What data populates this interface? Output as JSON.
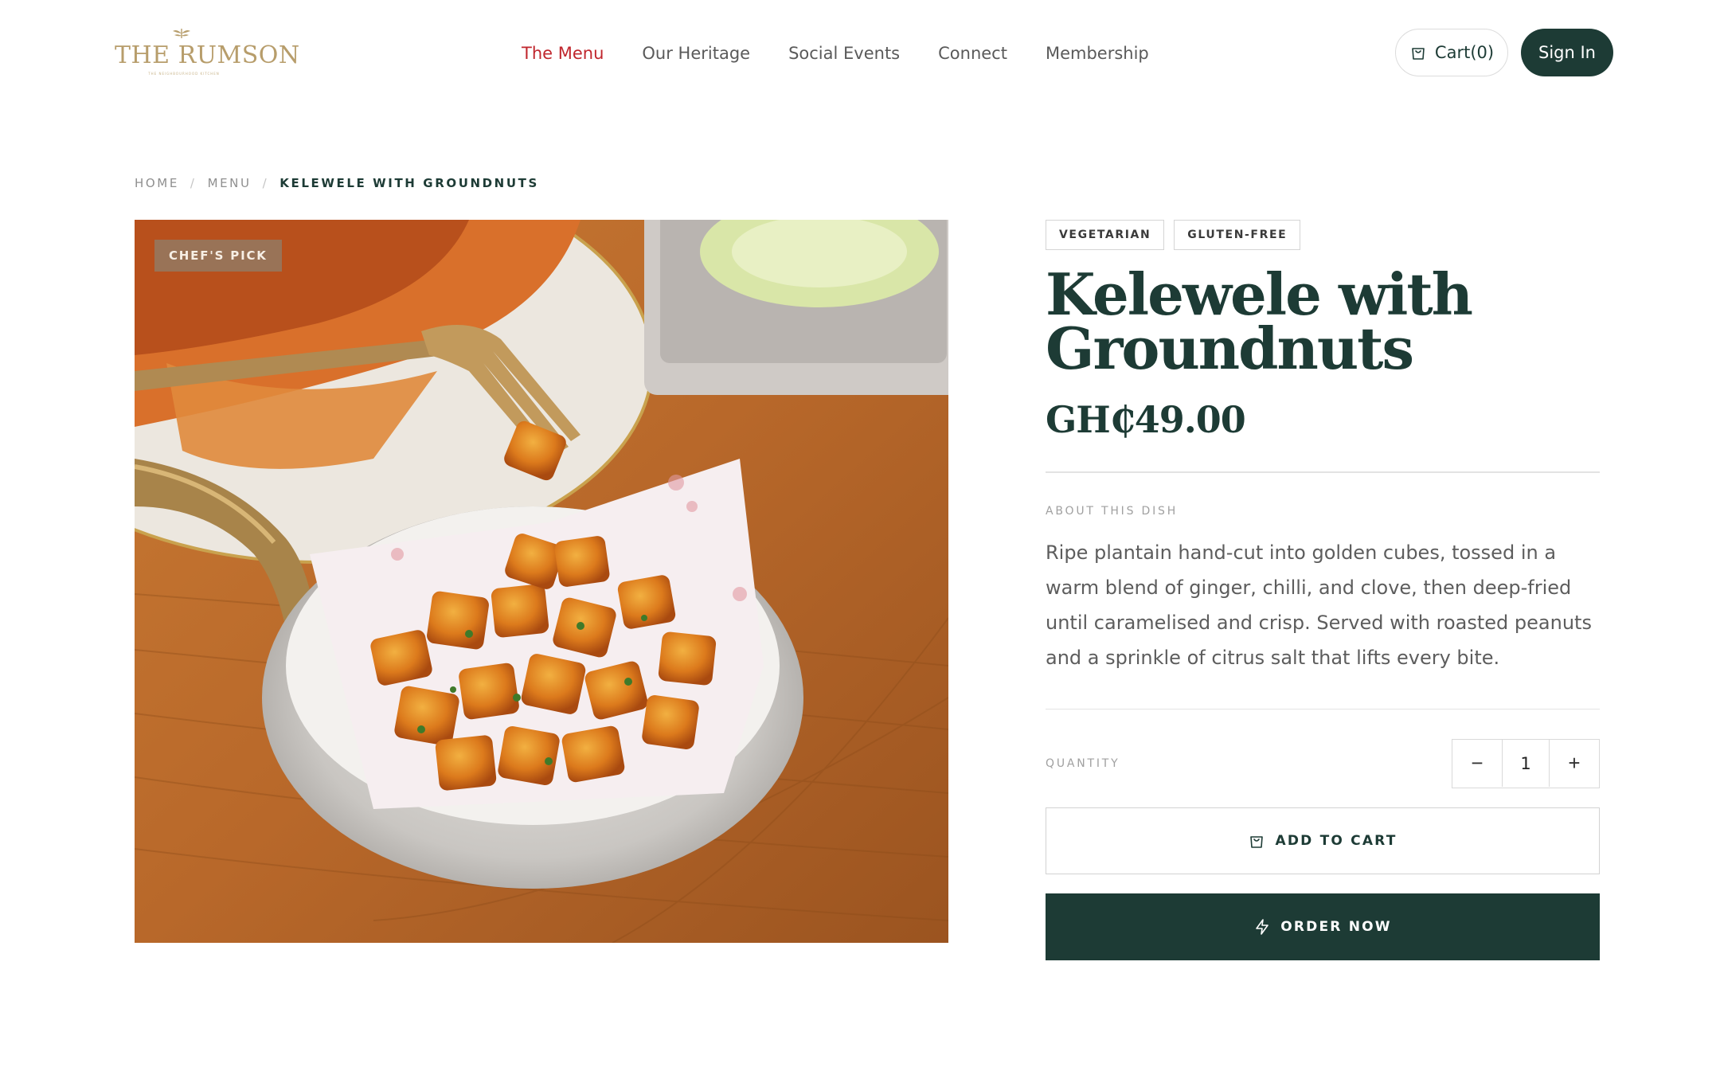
{
  "brand": {
    "name": "THE RUMSON",
    "tagline": "THE NEIGHBOURHOOD KITCHEN",
    "logo_icon": "leaf-crest-icon",
    "color": "#b79d6b"
  },
  "nav": {
    "items": [
      {
        "label": "The Menu",
        "active": true
      },
      {
        "label": "Our Heritage",
        "active": false
      },
      {
        "label": "Social Events",
        "active": false
      },
      {
        "label": "Connect",
        "active": false
      },
      {
        "label": "Membership",
        "active": false
      }
    ],
    "active_color": "#c0262d"
  },
  "header": {
    "cart_label": "Cart(0)",
    "cart_icon": "shopping-bag-icon",
    "signin_label": "Sign In"
  },
  "breadcrumb": {
    "items": [
      "HOME",
      "MENU"
    ],
    "separator": "/",
    "current": "KELEWELE WITH GROUNDNUTS"
  },
  "product": {
    "badge": "CHEF'S PICK",
    "tags": [
      "VEGETARIAN",
      "GLUTEN-FREE"
    ],
    "title_line1": "Kelewele with",
    "title_line2": "Groundnuts",
    "price": "GH₵49.00",
    "about_label": "ABOUT THIS DISH",
    "description": "Ripe plantain hand-cut into golden cubes, tossed in a warm blend of ginger, chilli, and clove, then deep-fried until caramelised and crisp. Served with roasted peanuts and a sprinkle of citrus salt that lifts every bite.",
    "quantity_label": "QUANTITY",
    "quantity": "1",
    "decrement_symbol": "−",
    "increment_symbol": "+",
    "add_to_cart_label": "ADD TO CART",
    "add_to_cart_icon": "shopping-bag-icon",
    "order_now_label": "ORDER NOW",
    "order_now_icon": "lightning-icon"
  },
  "theme": {
    "primary": "#1d3b35",
    "accent": "#c0262d",
    "badge_bg": "#96765c"
  }
}
